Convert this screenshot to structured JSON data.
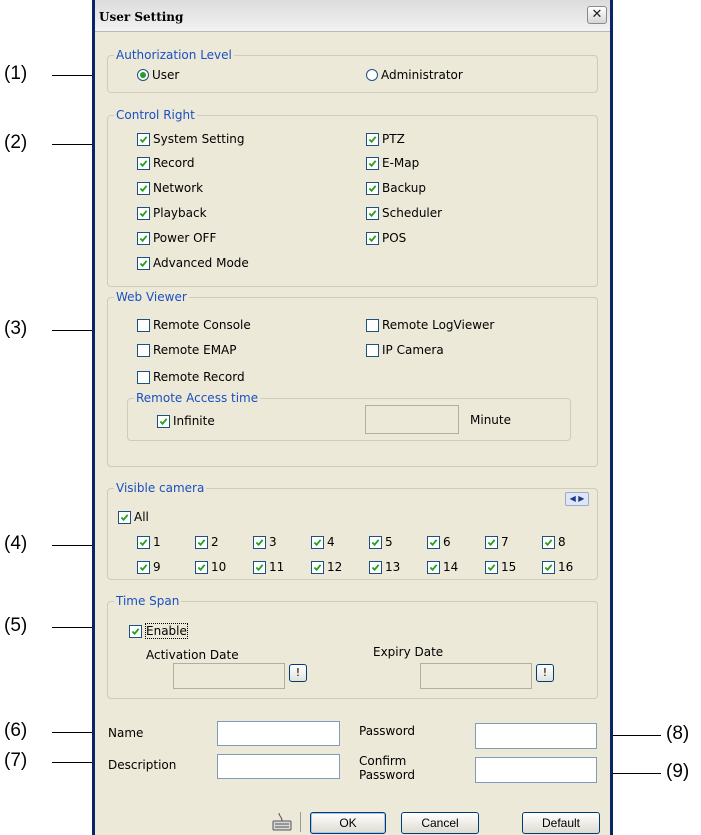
{
  "annotations": [
    "(1)",
    "(2)",
    "(3)",
    "(4)",
    "(5)",
    "(6)",
    "(7)",
    "(8)",
    "(9)"
  ],
  "window": {
    "title": "User Setting",
    "close_glyph": "✕"
  },
  "authorization": {
    "legend": "Authorization Level",
    "options": [
      {
        "label": "User",
        "selected": true
      },
      {
        "label": "Administrator",
        "selected": false
      }
    ]
  },
  "control_right": {
    "legend": "Control Right",
    "items": [
      {
        "label": "System Setting",
        "checked": true
      },
      {
        "label": "PTZ",
        "checked": true
      },
      {
        "label": "Record",
        "checked": true
      },
      {
        "label": "E-Map",
        "checked": true
      },
      {
        "label": "Network",
        "checked": true
      },
      {
        "label": "Backup",
        "checked": true
      },
      {
        "label": "Playback",
        "checked": true
      },
      {
        "label": "Scheduler",
        "checked": true
      },
      {
        "label": "Power OFF",
        "checked": true
      },
      {
        "label": "POS",
        "checked": true
      },
      {
        "label": "Advanced Mode",
        "checked": true
      }
    ]
  },
  "web_viewer": {
    "legend": "Web Viewer",
    "items": [
      {
        "label": "Remote Console",
        "checked": false
      },
      {
        "label": "Remote LogViewer",
        "checked": false
      },
      {
        "label": "Remote EMAP",
        "checked": false
      },
      {
        "label": "IP Camera",
        "checked": false
      },
      {
        "label": "Remote Record",
        "checked": false
      }
    ],
    "remote_access": {
      "legend": "Remote Access time",
      "infinite_label": "Infinite",
      "infinite_checked": true,
      "minutes_value": "",
      "unit_label": "Minute"
    }
  },
  "visible_camera": {
    "legend": "Visible camera",
    "nav_glyph": "◀ ▶",
    "all_label": "All",
    "all_checked": true,
    "cameras": [
      "1",
      "2",
      "3",
      "4",
      "5",
      "6",
      "7",
      "8",
      "9",
      "10",
      "11",
      "12",
      "13",
      "14",
      "15",
      "16"
    ]
  },
  "time_span": {
    "legend": "Time Span",
    "enable_label": "Enable",
    "enable_checked": true,
    "activation_label": "Activation Date",
    "activation_value": "",
    "expiry_label": "Expiry Date",
    "expiry_value": "",
    "picker_glyph": "!"
  },
  "account": {
    "name_label": "Name",
    "name_value": "",
    "password_label": "Password",
    "password_value": "",
    "description_label": "Description",
    "description_value": "",
    "confirm_label_line1": "Confirm",
    "confirm_label_line2": "Password",
    "confirm_value": ""
  },
  "buttons": {
    "ok": "OK",
    "cancel": "Cancel",
    "default": "Default"
  },
  "icons": {
    "keyboard": "keyboard-icon",
    "check": "check-icon"
  },
  "colors": {
    "window_bg": "#ece9d8",
    "legend_text": "#1b4fc2",
    "check_green": "#21a121",
    "frame_blue": "#0a246a"
  }
}
